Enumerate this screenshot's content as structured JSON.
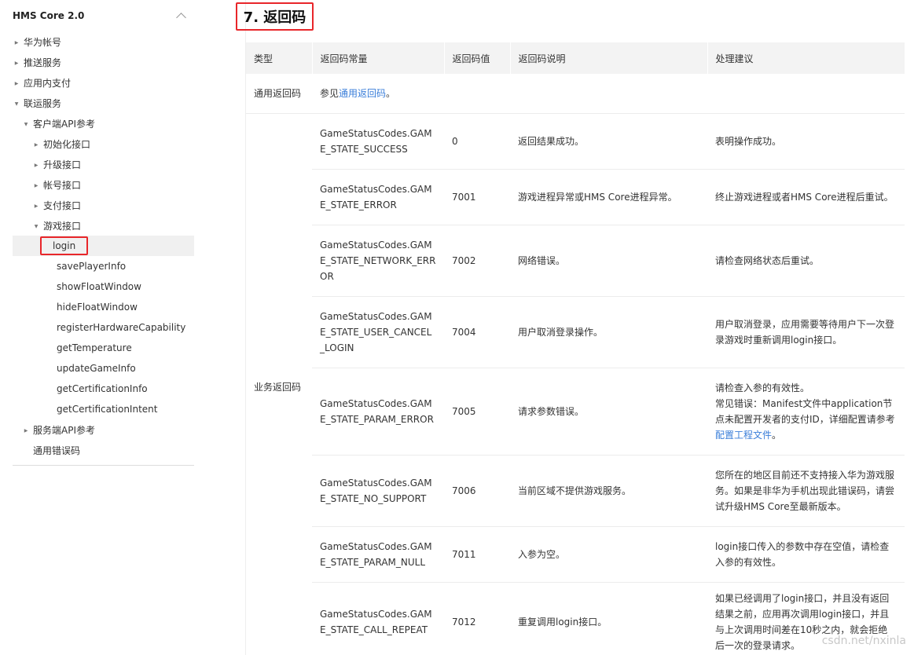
{
  "sidebar": {
    "title": "HMS Core 2.0",
    "items": [
      {
        "label": "华为帐号",
        "level": 0,
        "caret": "right"
      },
      {
        "label": "推送服务",
        "level": 0,
        "caret": "right"
      },
      {
        "label": "应用内支付",
        "level": 0,
        "caret": "right"
      },
      {
        "label": "联运服务",
        "level": 0,
        "caret": "down"
      },
      {
        "label": "客户端API参考",
        "level": 1,
        "caret": "down"
      },
      {
        "label": "初始化接口",
        "level": 2,
        "caret": "right"
      },
      {
        "label": "升级接口",
        "level": 2,
        "caret": "right"
      },
      {
        "label": "帐号接口",
        "level": 2,
        "caret": "right"
      },
      {
        "label": "支付接口",
        "level": 2,
        "caret": "right"
      },
      {
        "label": "游戏接口",
        "level": 2,
        "caret": "down"
      },
      {
        "label": "login",
        "level": 3,
        "caret": "",
        "active": true
      },
      {
        "label": "savePlayerInfo",
        "level": 3,
        "caret": ""
      },
      {
        "label": "showFloatWindow",
        "level": 3,
        "caret": ""
      },
      {
        "label": "hideFloatWindow",
        "level": 3,
        "caret": ""
      },
      {
        "label": "registerHardwareCapability",
        "level": 3,
        "caret": ""
      },
      {
        "label": "getTemperature",
        "level": 3,
        "caret": ""
      },
      {
        "label": "updateGameInfo",
        "level": 3,
        "caret": ""
      },
      {
        "label": "getCertificationInfo",
        "level": 3,
        "caret": ""
      },
      {
        "label": "getCertificationIntent",
        "level": 3,
        "caret": ""
      },
      {
        "label": "服务端API参考",
        "level": 1,
        "caret": "right"
      },
      {
        "label": "通用错误码",
        "level": 1,
        "caret": ""
      }
    ]
  },
  "main": {
    "title": "7. 返回码",
    "headers": [
      "类型",
      "返回码常量",
      "返回码值",
      "返回码说明",
      "处理建议"
    ],
    "general_row": {
      "type": "通用返回码",
      "prefix": "参见",
      "link": "通用返回码",
      "suffix": "。"
    },
    "business_type": "业务返回码",
    "rows": [
      {
        "constant": "GameStatusCodes.GAME_STATE_SUCCESS",
        "value": "0",
        "desc": "返回结果成功。",
        "advice": "表明操作成功。"
      },
      {
        "constant": "GameStatusCodes.GAME_STATE_ERROR",
        "value": "7001",
        "desc": "游戏进程异常或HMS Core进程异常。",
        "advice": "终止游戏进程或者HMS Core进程后重试。"
      },
      {
        "constant": "GameStatusCodes.GAME_STATE_NETWORK_ERROR",
        "value": "7002",
        "desc": "网络错误。",
        "advice": "请检查网络状态后重试。"
      },
      {
        "constant": "GameStatusCodes.GAME_STATE_USER_CANCEL_LOGIN",
        "value": "7004",
        "desc": "用户取消登录操作。",
        "advice": "用户取消登录，应用需要等待用户下一次登录游戏时重新调用login接口。"
      },
      {
        "constant": "GameStatusCodes.GAME_STATE_PARAM_ERROR",
        "value": "7005",
        "desc": "请求参数错误。",
        "advice": "请检查入参的有效性。",
        "advice2": "常见错误：Manifest文件中application节点未配置开发者的支付ID，详细配置请参考",
        "advice_link": "配置工程文件",
        "advice_suffix": "。"
      },
      {
        "constant": "GameStatusCodes.GAME_STATE_NO_SUPPORT",
        "value": "7006",
        "desc": "当前区域不提供游戏服务。",
        "advice": "您所在的地区目前还不支持接入华为游戏服务。如果是非华为手机出现此错误码，请尝试升级HMS Core至最新版本。"
      },
      {
        "constant": "GameStatusCodes.GAME_STATE_PARAM_NULL",
        "value": "7011",
        "desc": "入参为空。",
        "advice": "login接口传入的参数中存在空值，请检查入参的有效性。"
      },
      {
        "constant": "GameStatusCodes.GAME_STATE_CALL_REPEAT",
        "value": "7012",
        "desc": "重复调用login接口。",
        "advice": "如果已经调用了login接口，并且没有返回结果之前，应用再次调用login接口，并且与上次调用时间差在10秒之内，就会拒绝后一次的登录请求。"
      }
    ]
  },
  "watermark": "csdn.net/nxinla"
}
